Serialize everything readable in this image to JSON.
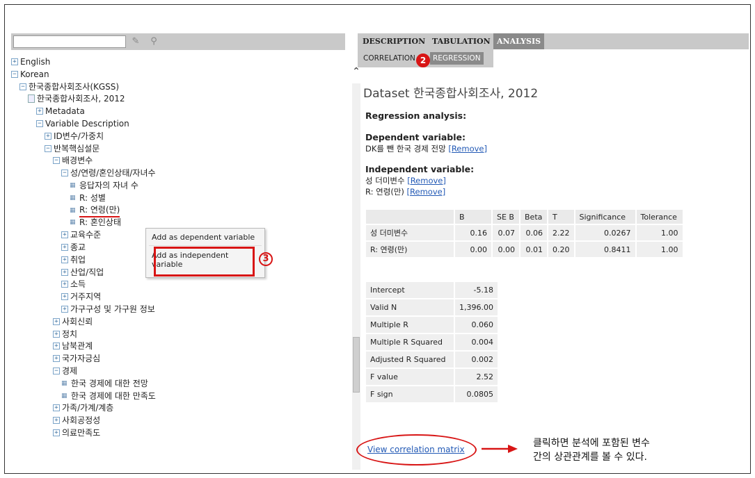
{
  "search": {
    "value": "",
    "placeholder": ""
  },
  "left_icons": [
    "pencil-icon",
    "search-icon"
  ],
  "tree": [
    {
      "label": "English",
      "kind": "toggle",
      "sym": "+"
    },
    {
      "label": "Korean",
      "kind": "toggle",
      "sym": "−"
    },
    {
      "label": "한국종합사회조사(KGSS)",
      "kind": "toggle",
      "sym": "−"
    },
    {
      "label": "한국종합사회조사, 2012",
      "kind": "doc"
    },
    {
      "label": "Metadata",
      "kind": "toggle",
      "sym": "+"
    },
    {
      "label": "Variable Description",
      "kind": "toggle",
      "sym": "−"
    },
    {
      "label": "ID변수/가중치",
      "kind": "toggle",
      "sym": "+"
    },
    {
      "label": "반복핵심설문",
      "kind": "toggle",
      "sym": "−"
    },
    {
      "label": "배경변수",
      "kind": "toggle",
      "sym": "−"
    },
    {
      "label": "성/연령/혼인상태/자녀수",
      "kind": "toggle",
      "sym": "−"
    },
    {
      "label": "응답자의 자녀 수",
      "kind": "leaf"
    },
    {
      "label": "R: 성별",
      "kind": "leaf"
    },
    {
      "label": "R: 연령(만)",
      "kind": "leaf"
    },
    {
      "label": "R: 혼인상태",
      "kind": "leaf"
    },
    {
      "label": "교육수준",
      "kind": "toggle",
      "sym": "+"
    },
    {
      "label": "종교",
      "kind": "toggle",
      "sym": "+"
    },
    {
      "label": "취업",
      "kind": "toggle",
      "sym": "+"
    },
    {
      "label": "산업/직업",
      "kind": "toggle",
      "sym": "+"
    },
    {
      "label": "소득",
      "kind": "toggle",
      "sym": "+"
    },
    {
      "label": "거주지역",
      "kind": "toggle",
      "sym": "+"
    },
    {
      "label": "가구구성 및 가구원 정보",
      "kind": "toggle",
      "sym": "+"
    },
    {
      "label": "사회신뢰",
      "kind": "toggle",
      "sym": "+"
    },
    {
      "label": "정치",
      "kind": "toggle",
      "sym": "+"
    },
    {
      "label": "남북관계",
      "kind": "toggle",
      "sym": "+"
    },
    {
      "label": "국가자긍심",
      "kind": "toggle",
      "sym": "+"
    },
    {
      "label": "경제",
      "kind": "toggle",
      "sym": "−"
    },
    {
      "label": "한국 경제에 대한 전망",
      "kind": "leaf"
    },
    {
      "label": "한국 경제에 대한 만족도",
      "kind": "leaf"
    },
    {
      "label": "가족/가계/계층",
      "kind": "toggle",
      "sym": "+"
    },
    {
      "label": "사회공정성",
      "kind": "toggle",
      "sym": "+"
    },
    {
      "label": "의료만족도",
      "kind": "toggle",
      "sym": "+"
    }
  ],
  "context_menu": {
    "dependent": "Add as dependent variable",
    "independent_1": "Add as independent",
    "independent_2": "variable"
  },
  "badges": {
    "two": "2",
    "three": "3"
  },
  "tabs": [
    "DESCRIPTION",
    "TABULATION",
    "ANALYSIS"
  ],
  "subtabs": [
    "CORRELATION",
    "REGRESSION"
  ],
  "dataset": {
    "label": "Dataset",
    "name": "한국종합사회조사, 2012"
  },
  "regression_heading": "Regression analysis:",
  "dependent": {
    "heading": "Dependent variable:",
    "variable": "DK를 뺀 한국 경제 전망",
    "remove": "[Remove]"
  },
  "independent": {
    "heading": "Independent variable:",
    "vars": [
      {
        "name": "성 더미변수",
        "remove": "[Remove]"
      },
      {
        "name": "R: 연령(만)",
        "remove": "[Remove]"
      }
    ]
  },
  "coef_table": {
    "headers": [
      "",
      "B",
      "SE B",
      "Beta",
      "T",
      "Significance",
      "Tolerance"
    ],
    "rows": [
      [
        "성 더미변수",
        "0.16",
        "0.07",
        "0.06",
        "2.22",
        "0.0267",
        "1.00"
      ],
      [
        "R: 연령(만)",
        "0.00",
        "0.00",
        "0.01",
        "0.20",
        "0.8411",
        "1.00"
      ]
    ]
  },
  "stats_table": [
    [
      "Intercept",
      "-5.18"
    ],
    [
      "Valid N",
      "1,396.00"
    ],
    [
      "Multiple R",
      "0.060"
    ],
    [
      "Multiple R Squared",
      "0.004"
    ],
    [
      "Adjusted R Squared",
      "0.002"
    ],
    [
      "F value",
      "2.52"
    ],
    [
      "F sign",
      "0.0805"
    ]
  ],
  "correlation_link": "View correlation matrix",
  "annotation": {
    "line1": "클릭하면 분석에 포함된 변수",
    "line2": "간의 상관관계를 볼 수 있다."
  },
  "colors": {
    "highlight_red": "#d81515",
    "link_blue": "#2259b5",
    "tab_active": "#8a8a8a",
    "tab_bar": "#c9c9c9"
  }
}
